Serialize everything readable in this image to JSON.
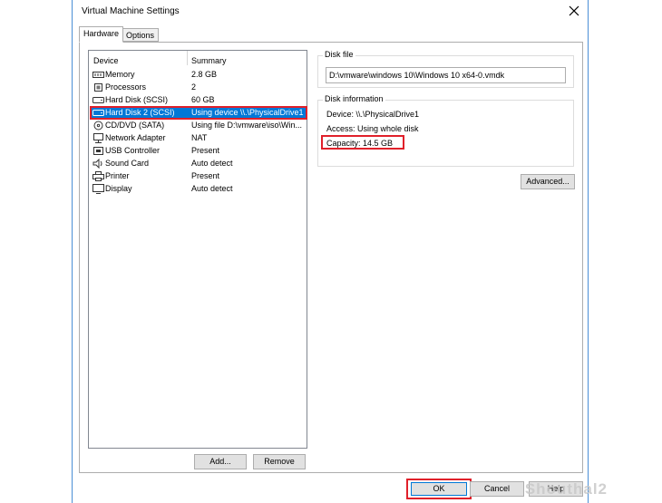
{
  "window": {
    "title": "Virtual Machine Settings"
  },
  "tabs": [
    {
      "label": "Hardware"
    },
    {
      "label": "Options"
    }
  ],
  "device_list": {
    "headers": {
      "device": "Device",
      "summary": "Summary"
    },
    "rows": [
      {
        "icon": "memory-icon",
        "device": "Memory",
        "summary": "2.8 GB"
      },
      {
        "icon": "processor-icon",
        "device": "Processors",
        "summary": "2"
      },
      {
        "icon": "hard-disk-icon",
        "device": "Hard Disk (SCSI)",
        "summary": "60 GB"
      },
      {
        "icon": "hard-disk-icon",
        "device": "Hard Disk 2 (SCSI)",
        "summary": "Using device \\\\.\\PhysicalDrive1",
        "selected": true
      },
      {
        "icon": "cd-dvd-icon",
        "device": "CD/DVD (SATA)",
        "summary": "Using file D:\\vmware\\iso\\Win..."
      },
      {
        "icon": "network-adapter-icon",
        "device": "Network Adapter",
        "summary": "NAT"
      },
      {
        "icon": "usb-controller-icon",
        "device": "USB Controller",
        "summary": "Present"
      },
      {
        "icon": "sound-card-icon",
        "device": "Sound Card",
        "summary": "Auto detect"
      },
      {
        "icon": "printer-icon",
        "device": "Printer",
        "summary": "Present"
      },
      {
        "icon": "display-icon",
        "device": "Display",
        "summary": "Auto detect"
      }
    ]
  },
  "list_buttons": {
    "add": "Add...",
    "remove": "Remove"
  },
  "disk_file": {
    "label": "Disk file",
    "value": "D:\\vmware\\windows 10\\Windows 10 x64-0.vmdk"
  },
  "disk_information": {
    "label": "Disk information",
    "device": "Device:  \\\\.\\PhysicalDrive1",
    "access": "Access:  Using whole disk",
    "capacity": "Capacity:  14.5 GB"
  },
  "advanced_button": "Advanced...",
  "footer": {
    "ok": "OK",
    "cancel": "Cancel",
    "help": "Help"
  },
  "watermark": "Shouthal2",
  "colors": {
    "selection": "#0078d7",
    "highlight": "#e0202a",
    "window_border": "#4a8fd6"
  }
}
